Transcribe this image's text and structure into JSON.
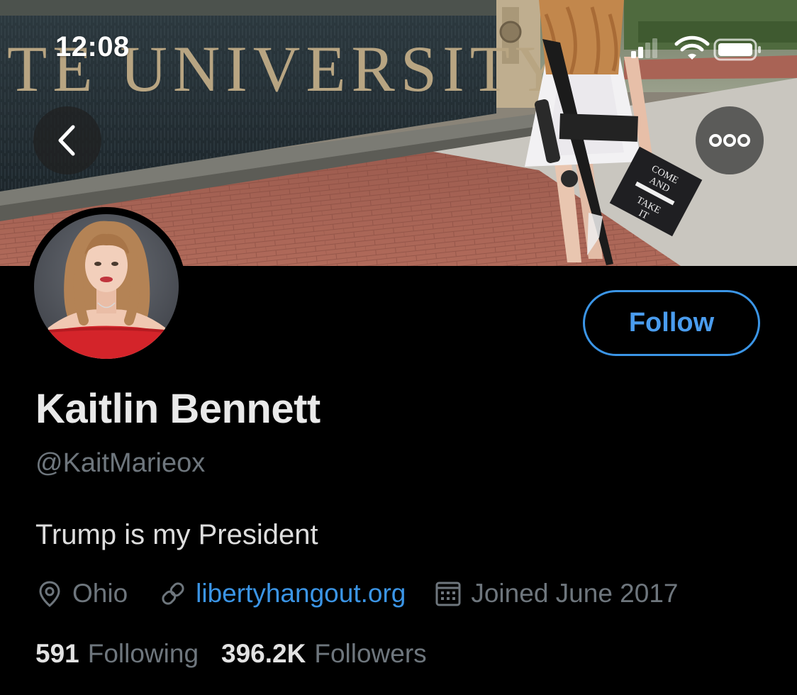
{
  "status_bar": {
    "time": "12:08",
    "icons": [
      "signal-icon",
      "wifi-icon",
      "battery-icon"
    ]
  },
  "banner": {
    "sign_text": "TE UNIVERSITY",
    "cap_text_1": "COME",
    "cap_text_2": "AND",
    "cap_text_3": "TAKE",
    "cap_text_4": "IT"
  },
  "nav": {
    "back_icon": "chevron-left-icon",
    "more_icon": "more-horizontal-icon"
  },
  "profile": {
    "display_name": "Kaitlin Bennett",
    "handle": "@KaitMarieox",
    "bio": "Trump is my President",
    "location": "Ohio",
    "website": "libertyhangout.org",
    "joined": "Joined June 2017",
    "following_count": "591",
    "following_label": "Following",
    "followers_count": "396.2K",
    "followers_label": "Followers",
    "follow_button": "Follow"
  },
  "colors": {
    "background": "#000000",
    "accent": "#3b95e6",
    "secondary_text": "#6e767d",
    "primary_text": "#e7e9ea"
  }
}
